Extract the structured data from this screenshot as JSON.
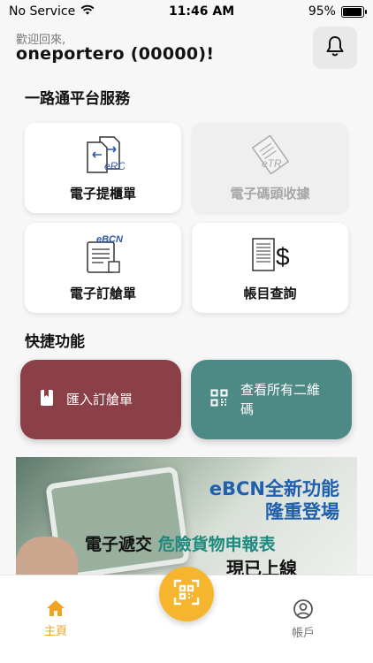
{
  "status_bar": {
    "carrier": "No Service",
    "time": "11:46 AM",
    "battery_text": "95%",
    "battery_level": 0.95
  },
  "header": {
    "greeting": "歡迎回來,",
    "username": "oneportero (00000)!"
  },
  "icons": {
    "bell": "bell-icon",
    "wifi": "wifi-icon",
    "battery": "battery-icon",
    "import": "bookmark-icon",
    "qr": "qr-code-icon",
    "home": "home-icon",
    "account": "user-circle-icon",
    "scan": "qr-scan-icon"
  },
  "services": {
    "title": "一路通平台服務",
    "items": [
      {
        "label": "電子提櫃單",
        "icon_text": "eRO",
        "enabled": true
      },
      {
        "label": "電子碼頭收據",
        "icon_text": "eTR",
        "enabled": false
      },
      {
        "label": "電子訂艙單",
        "icon_text": "eBCN",
        "enabled": true
      },
      {
        "label": "帳目查詢",
        "icon_text": "$",
        "enabled": true
      }
    ]
  },
  "quick": {
    "title": "快捷功能",
    "items": [
      {
        "label": "匯入訂艙單",
        "color": "#8b3f46"
      },
      {
        "label_line1": "查看所有二維",
        "label_line2": "碼",
        "color": "#4d8a85"
      }
    ]
  },
  "banner": {
    "line1": "eBCN全新功能",
    "line2": "隆重登場",
    "line3_plain": "電子遞交 ",
    "line3_accent": "危險貨物申報表",
    "line4": "現已上線"
  },
  "tabbar": {
    "home": "主頁",
    "account": "帳戶",
    "active_color": "#f0a424",
    "scan_color": "#f6b52e"
  }
}
